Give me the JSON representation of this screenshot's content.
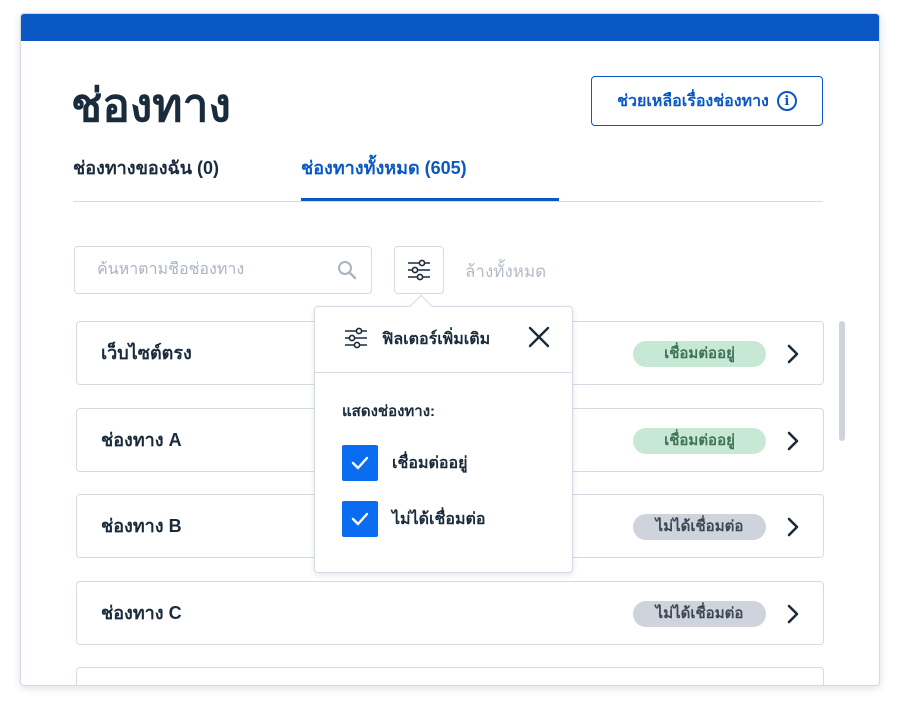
{
  "header": {
    "title": "ช่องทาง",
    "help_button": "ช่วยเหลือเรื่องช่องทาง",
    "help_icon": "info-icon"
  },
  "tabs": [
    {
      "label": "ช่องทางของฉัน (0)",
      "active": false
    },
    {
      "label": "ช่องทางทั้งหมด (605)",
      "active": true
    }
  ],
  "toolbar": {
    "search_placeholder": "ค้นหาตามชื่อช่องทาง",
    "search_value": "",
    "search_icon": "search-icon",
    "filter_icon": "sliders-icon",
    "clear_all": "ล้างทั้งหมด"
  },
  "channels": [
    {
      "name": "เว็บไซต์ตรง",
      "status": "เชื่อมต่ออยู่",
      "connected": true
    },
    {
      "name": "ช่องทาง A",
      "status": "เชื่อมต่ออยู่",
      "connected": true
    },
    {
      "name": "ช่องทาง B",
      "status": "ไม่ได้เชื่อมต่อ",
      "connected": false
    },
    {
      "name": "ช่องทาง C",
      "status": "ไม่ได้เชื่อมต่อ",
      "connected": false
    }
  ],
  "filter_popover": {
    "title": "ฟิลเตอร์เพิ่มเติม",
    "section_label": "แสดงช่องทาง:",
    "options": [
      {
        "label": "เชื่อมต่ออยู่",
        "checked": true
      },
      {
        "label": "ไม่ได้เชื่อมต่อ",
        "checked": true
      }
    ]
  },
  "colors": {
    "brand_blue": "#0a58c6",
    "checkbox_blue": "#0a6cf0",
    "connected_bg": "#c7e8d4",
    "disconnected_bg": "#cfd4dc"
  }
}
